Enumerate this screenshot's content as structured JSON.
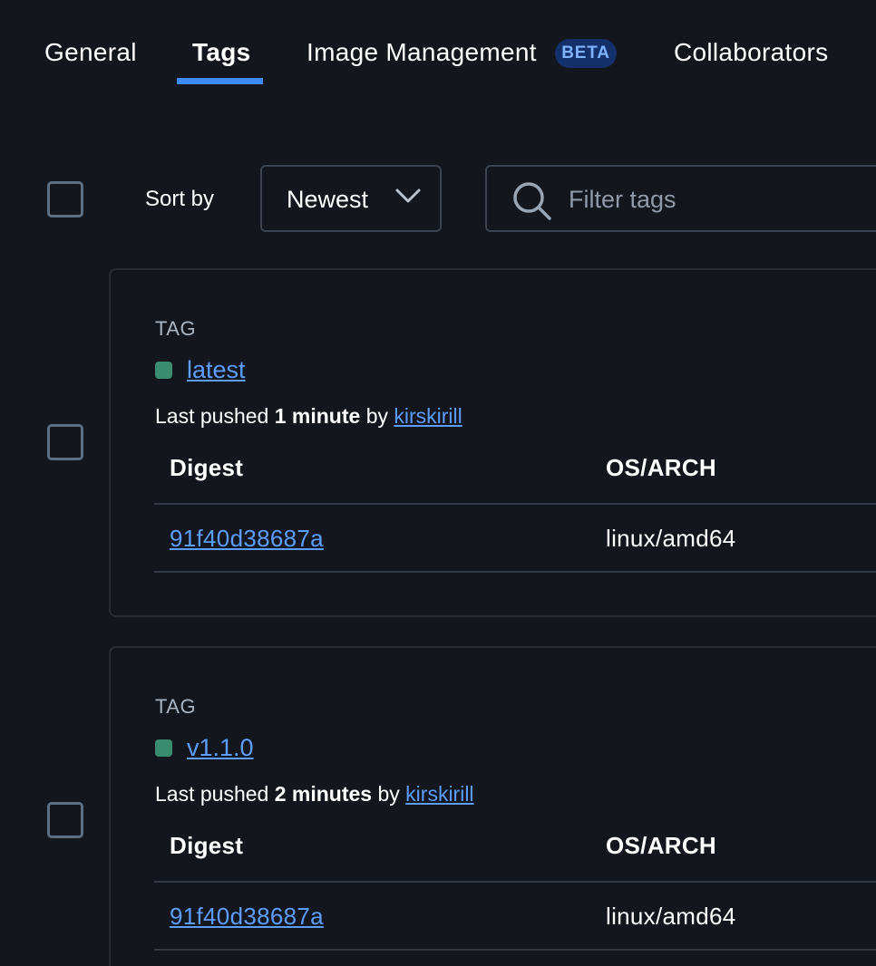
{
  "tabs": [
    {
      "label": "General",
      "active": false
    },
    {
      "label": "Tags",
      "active": true
    },
    {
      "label": "Image Management",
      "active": false,
      "badge": "BETA"
    },
    {
      "label": "Collaborators",
      "active": false
    }
  ],
  "toolbar": {
    "sort_label": "Sort by",
    "sort_value": "Newest",
    "filter_placeholder": "Filter tags"
  },
  "tags": [
    {
      "heading": "TAG",
      "name": "latest",
      "pushed_prefix": "Last pushed",
      "pushed_time": "1 minute",
      "pushed_by_word": "by",
      "pushed_user": "kirskirill",
      "columns": {
        "digest": "Digest",
        "os_arch": "OS/ARCH"
      },
      "rows": [
        {
          "digest": "91f40d38687a",
          "os_arch": "linux/amd64"
        }
      ]
    },
    {
      "heading": "TAG",
      "name": "v1.1.0",
      "pushed_prefix": "Last pushed",
      "pushed_time": "2 minutes",
      "pushed_by_word": "by",
      "pushed_user": "kirskirill",
      "columns": {
        "digest": "Digest",
        "os_arch": "OS/ARCH"
      },
      "rows": [
        {
          "digest": "91f40d38687a",
          "os_arch": "linux/amd64"
        }
      ]
    }
  ],
  "colors": {
    "background": "#13161c",
    "accent": "#3d8cf5",
    "link": "#5c9dff",
    "status_active": "#3a8c70",
    "badge_bg": "#14306a"
  },
  "icons": {
    "sort": "chevron-down-icon",
    "filter": "search-icon",
    "status": "status-dot-icon"
  }
}
